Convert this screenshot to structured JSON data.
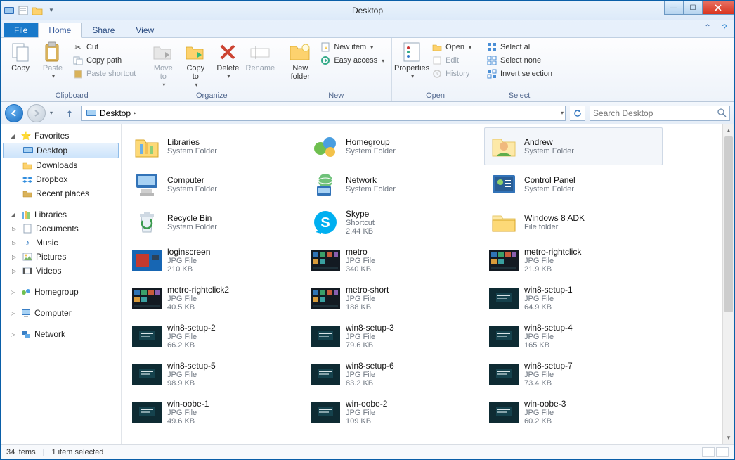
{
  "window": {
    "title": "Desktop"
  },
  "tabs": {
    "file": "File",
    "home": "Home",
    "share": "Share",
    "view": "View"
  },
  "ribbon": {
    "clipboard": {
      "label": "Clipboard",
      "copy": "Copy",
      "paste": "Paste",
      "cut": "Cut",
      "copypath": "Copy path",
      "pasteshortcut": "Paste shortcut"
    },
    "organize": {
      "label": "Organize",
      "moveto": "Move\nto",
      "copyto": "Copy\nto",
      "delete": "Delete",
      "rename": "Rename"
    },
    "new": {
      "label": "New",
      "newfolder": "New\nfolder",
      "newitem": "New item",
      "easyaccess": "Easy access"
    },
    "open": {
      "label": "Open",
      "properties": "Properties",
      "open": "Open",
      "edit": "Edit",
      "history": "History"
    },
    "select": {
      "label": "Select",
      "selectall": "Select all",
      "selectnone": "Select none",
      "invert": "Invert selection"
    }
  },
  "nav": {
    "location": "Desktop",
    "search_placeholder": "Search Desktop"
  },
  "sidebar": {
    "favorites": "Favorites",
    "desktop": "Desktop",
    "downloads": "Downloads",
    "dropbox": "Dropbox",
    "recent": "Recent places",
    "libraries": "Libraries",
    "documents": "Documents",
    "music": "Music",
    "pictures": "Pictures",
    "videos": "Videos",
    "homegroup": "Homegroup",
    "computer": "Computer",
    "network": "Network"
  },
  "items": [
    {
      "name": "Libraries",
      "type": "System Folder",
      "size": "",
      "icon": "libraries"
    },
    {
      "name": "Homegroup",
      "type": "System Folder",
      "size": "",
      "icon": "homegroup"
    },
    {
      "name": "Andrew",
      "type": "System Folder",
      "size": "",
      "icon": "user",
      "selected": true
    },
    {
      "name": "Computer",
      "type": "System Folder",
      "size": "",
      "icon": "computer"
    },
    {
      "name": "Network",
      "type": "System Folder",
      "size": "",
      "icon": "network"
    },
    {
      "name": "Control Panel",
      "type": "System Folder",
      "size": "",
      "icon": "control-panel"
    },
    {
      "name": "Recycle Bin",
      "type": "System Folder",
      "size": "",
      "icon": "recycle"
    },
    {
      "name": "Skype",
      "type": "Shortcut",
      "size": "2.44 KB",
      "icon": "skype"
    },
    {
      "name": "Windows 8 ADK",
      "type": "File folder",
      "size": "",
      "icon": "folder"
    },
    {
      "name": "loginscreen",
      "type": "JPG File",
      "size": "210 KB",
      "icon": "jpg-blue"
    },
    {
      "name": "metro",
      "type": "JPG File",
      "size": "340 KB",
      "icon": "jpg-dark"
    },
    {
      "name": "metro-rightclick",
      "type": "JPG File",
      "size": "21.9 KB",
      "icon": "jpg-dark"
    },
    {
      "name": "metro-rightclick2",
      "type": "JPG File",
      "size": "40.5 KB",
      "icon": "jpg-dark"
    },
    {
      "name": "metro-short",
      "type": "JPG File",
      "size": "188 KB",
      "icon": "jpg-dark"
    },
    {
      "name": "win8-setup-1",
      "type": "JPG File",
      "size": "64.9 KB",
      "icon": "jpg-teal"
    },
    {
      "name": "win8-setup-2",
      "type": "JPG File",
      "size": "66.2 KB",
      "icon": "jpg-teal"
    },
    {
      "name": "win8-setup-3",
      "type": "JPG File",
      "size": "79.6 KB",
      "icon": "jpg-teal"
    },
    {
      "name": "win8-setup-4",
      "type": "JPG File",
      "size": "165 KB",
      "icon": "jpg-teal"
    },
    {
      "name": "win8-setup-5",
      "type": "JPG File",
      "size": "98.9 KB",
      "icon": "jpg-teal"
    },
    {
      "name": "win8-setup-6",
      "type": "JPG File",
      "size": "83.2 KB",
      "icon": "jpg-teal"
    },
    {
      "name": "win8-setup-7",
      "type": "JPG File",
      "size": "73.4 KB",
      "icon": "jpg-teal"
    },
    {
      "name": "win-oobe-1",
      "type": "JPG File",
      "size": "49.6 KB",
      "icon": "jpg-teal"
    },
    {
      "name": "win-oobe-2",
      "type": "JPG File",
      "size": "109 KB",
      "icon": "jpg-teal"
    },
    {
      "name": "win-oobe-3",
      "type": "JPG File",
      "size": "60.2 KB",
      "icon": "jpg-teal"
    }
  ],
  "status": {
    "count": "34 items",
    "selected": "1 item selected"
  }
}
